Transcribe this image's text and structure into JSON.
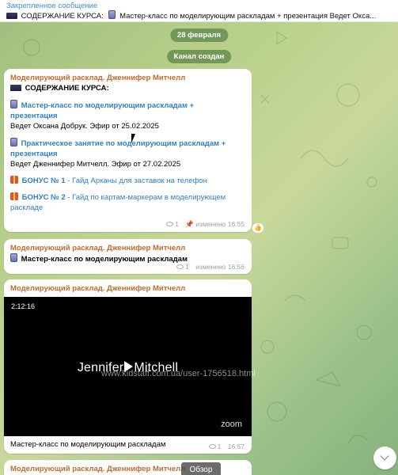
{
  "pinned": {
    "title": "Закрепленное сообщение",
    "text": "СОДЕРЖАНИЕ КУРСА:",
    "text2": "Мастер-класс по моделирующим раскладам + презентация Ведет Окса..."
  },
  "date_pill": "28 февраля",
  "channel_pill": "Канал создан",
  "msg1": {
    "author": "Моделирующий расклад. Дженнифер Митчелл",
    "heading": "СОДЕРЖАНИЕ КУРСА:",
    "item1_title_1": "Мастер-класс по моделирующим раскладам +",
    "item1_title_2": "презентация",
    "item1_desc": "Ведет Оксана Добрук. Эфир от 25.02.2025",
    "item2_title_1": "Практическое занятие по моделирующим раскладам +",
    "item2_title_2": "презентация",
    "item2_desc": "Ведет Дженнифер Митчелл. Эфир от 27.02.2025",
    "bonus1_label": "БОНУС № 1",
    "bonus1_link": " - Гайд Арканы для заставок на телефон",
    "bonus2_label": "БОНУС № 2",
    "bonus2_link_1": " - Гайд по картам-маркерам в моделирующем",
    "bonus2_link_2": "раскладе",
    "views": "1",
    "edited": "изменено 16:55",
    "reaction": "👍"
  },
  "msg2": {
    "author": "Моделирующий расклад. Дженнифер Митчелл",
    "text": "Мастер-класс по моделирующим раскладам",
    "views": "1",
    "edited": "изменено 16:56"
  },
  "msg3": {
    "author": "Моделирующий расклад. Дженнифер Митчелл",
    "video_duration": "2:12:16",
    "video_name_left": "Jennifer",
    "video_name_right": "Mitchell",
    "zoom": "zoom",
    "caption": "Мастер-класс по моделирующим раскладам",
    "views": "1",
    "time": "16:57"
  },
  "msg4": {
    "author": "Моделирующий расклад. Дженнифер Митчелл"
  },
  "watermark": "www.kidstaff.com.ua/user-1756518.html",
  "overview_label": "Обзор",
  "colors": {
    "accent_link": "#2f80c8",
    "author": "#c4692a",
    "pill": "#5a8246"
  }
}
